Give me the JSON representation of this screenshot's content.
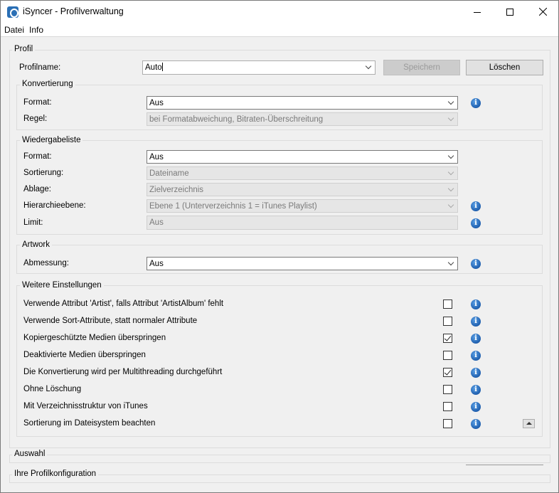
{
  "window": {
    "title": "iSyncer - Profilverwaltung"
  },
  "menu": {
    "items": [
      "Datei",
      "Info"
    ]
  },
  "profil": {
    "legend": "Profil",
    "name_label": "Profilname:",
    "name_value": "Auto",
    "save_label": "Speichern",
    "delete_label": "Löschen"
  },
  "konvertierung": {
    "legend": "Konvertierung",
    "format_label": "Format:",
    "format_value": "Aus",
    "regel_label": "Regel:",
    "regel_value": "bei Formatabweichung, Bitraten-Überschreitung"
  },
  "wiedergabeliste": {
    "legend": "Wiedergabeliste",
    "format_label": "Format:",
    "format_value": "Aus",
    "sortierung_label": "Sortierung:",
    "sortierung_value": "Dateiname",
    "ablage_label": "Ablage:",
    "ablage_value": "Zielverzeichnis",
    "hierarchie_label": "Hierarchieebene:",
    "hierarchie_value": "Ebene 1 (Unterverzeichnis 1 = iTunes Playlist)",
    "limit_label": "Limit:",
    "limit_value": "Aus"
  },
  "artwork": {
    "legend": "Artwork",
    "abmessung_label": "Abmessung:",
    "abmessung_value": "Aus"
  },
  "weitere": {
    "legend": "Weitere Einstellungen",
    "items": [
      {
        "label": "Verwende Attribut 'Artist', falls Attribut 'ArtistAlbum' fehlt",
        "checked": false
      },
      {
        "label": "Verwende Sort-Attribute, statt normaler Attribute",
        "checked": false
      },
      {
        "label": "Kopiergeschützte Medien überspringen",
        "checked": true
      },
      {
        "label": "Deaktivierte Medien überspringen",
        "checked": false
      },
      {
        "label": "Die Konvertierung wird per Multithreading durchgeführt",
        "checked": true
      },
      {
        "label": "Ohne Löschung",
        "checked": false
      },
      {
        "label": "Mit Verzeichnisstruktur von iTunes",
        "checked": false
      },
      {
        "label": "Sortierung im Dateisystem beachten",
        "checked": false
      }
    ]
  },
  "auswahl": {
    "legend": "Auswahl"
  },
  "konfiguration": {
    "legend": "Ihre Profilkonfiguration"
  },
  "icons": {
    "info": "info-icon",
    "app": "isyncer-app-icon"
  }
}
